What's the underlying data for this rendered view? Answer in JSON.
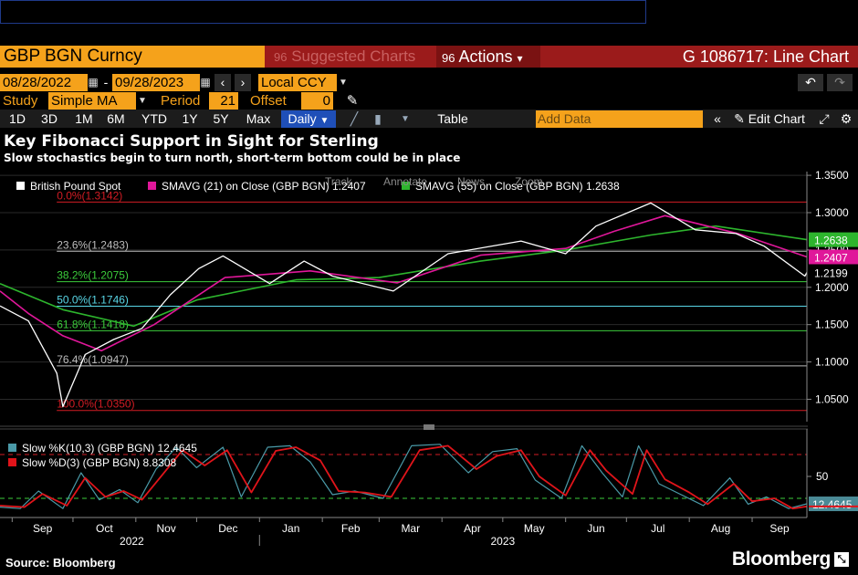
{
  "header": {
    "ticker": "GBP BGN Curncy",
    "suggested": "Suggested Charts",
    "actions": "Actions",
    "actions_prefix": "96",
    "suggested_prefix": "96",
    "chart_id": "G 1086717: Line Chart"
  },
  "range": {
    "start": "08/28/2022",
    "end": "09/28/2023",
    "currency": "Local CCY"
  },
  "study": {
    "label": "Study",
    "type": "Simple MA",
    "period_label": "Period",
    "period": "21",
    "offset_label": "Offset",
    "offset": "0"
  },
  "periods": [
    "1D",
    "3D",
    "1M",
    "6M",
    "YTD",
    "1Y",
    "5Y",
    "Max"
  ],
  "frequency": "Daily",
  "toolbar": {
    "table": "Table",
    "add_data_placeholder": "Add Data",
    "edit_chart": "Edit Chart"
  },
  "headline": "Key Fibonacci Support in Sight for Sterling",
  "subheadline": "Slow stochastics begin to turn north, short-term bottom could be in place",
  "chart_tools": [
    "Track",
    "Annotate",
    "News",
    "Zoom"
  ],
  "footer": {
    "source": "Source: Bloomberg",
    "brand": "Bloomberg"
  },
  "colors": {
    "price": "#ffffff",
    "sma21": "#e0179a",
    "sma55": "#2db52d",
    "k_line": "#4a9aa8",
    "d_line": "#e0141a",
    "accent": "#f5a21b",
    "title_bar": "#9b1b1b"
  },
  "chart_data": [
    {
      "type": "line",
      "legend": [
        {
          "name": "British Pound Spot",
          "value": ""
        },
        {
          "name": "SMAVG (21)  on Close (GBP BGN)",
          "value": "1.2407"
        },
        {
          "name": "SMAVG (55)  on Close (GBP BGN)",
          "value": "1.2638"
        }
      ],
      "series": [
        {
          "name": "British Pound Spot",
          "last": 1.2199,
          "last_label": "1.2199",
          "x": [
            "2022-08-26",
            "2022-09-09",
            "2022-09-23",
            "2022-09-26",
            "2022-10-07",
            "2022-10-21",
            "2022-11-04",
            "2022-11-18",
            "2022-12-02",
            "2022-12-14",
            "2023-01-06",
            "2023-01-23",
            "2023-02-06",
            "2023-03-08",
            "2023-04-04",
            "2023-05-10",
            "2023-06-01",
            "2023-06-16",
            "2023-07-13",
            "2023-08-04",
            "2023-08-24",
            "2023-09-07",
            "2023-09-27",
            "2023-09-28"
          ],
          "values": [
            1.175,
            1.155,
            1.085,
            1.04,
            1.11,
            1.13,
            1.145,
            1.19,
            1.225,
            1.242,
            1.205,
            1.235,
            1.215,
            1.195,
            1.245,
            1.262,
            1.245,
            1.282,
            1.313,
            1.277,
            1.272,
            1.255,
            1.215,
            1.2199
          ]
        },
        {
          "name": "SMAVG (21)",
          "last": 1.2407,
          "last_label": "1.2407",
          "x": [
            "2022-08-26",
            "2022-09-09",
            "2022-09-26",
            "2022-10-15",
            "2022-11-10",
            "2022-12-15",
            "2023-01-26",
            "2023-03-10",
            "2023-04-20",
            "2023-06-01",
            "2023-06-25",
            "2023-07-20",
            "2023-08-25",
            "2023-09-28"
          ],
          "values": [
            1.195,
            1.165,
            1.135,
            1.115,
            1.15,
            1.213,
            1.222,
            1.206,
            1.243,
            1.252,
            1.275,
            1.296,
            1.272,
            1.2407
          ]
        },
        {
          "name": "SMAVG (55)",
          "last": 1.2638,
          "last_label": "1.2638",
          "x": [
            "2022-08-26",
            "2022-09-26",
            "2022-10-31",
            "2022-12-01",
            "2023-01-19",
            "2023-03-01",
            "2023-04-20",
            "2023-06-01",
            "2023-07-13",
            "2023-08-14",
            "2023-09-28"
          ],
          "values": [
            1.205,
            1.17,
            1.148,
            1.183,
            1.21,
            1.213,
            1.235,
            1.25,
            1.27,
            1.282,
            1.2638
          ]
        }
      ],
      "fibonacci": [
        {
          "label": "0.0%(1.3142)",
          "value": 1.3142,
          "color": "#d21c24"
        },
        {
          "label": "23.6%(1.2483)",
          "value": 1.2483,
          "color": "#bdbdbd"
        },
        {
          "label": "38.2%(1.2075)",
          "value": 1.2075,
          "color": "#3bcc3b"
        },
        {
          "label": "50.0%(1.1746)",
          "value": 1.1746,
          "color": "#59d6e6"
        },
        {
          "label": "61.8%(1.1418)",
          "value": 1.1418,
          "color": "#3bcc3b"
        },
        {
          "label": "76.4%(1.0947)",
          "value": 1.0947,
          "color": "#bdbdbd"
        },
        {
          "label": "100.0%(1.0350)",
          "value": 1.035,
          "color": "#d21c24"
        }
      ],
      "yticks": [
        1.35,
        1.3,
        1.25,
        1.2,
        1.15,
        1.1,
        1.05
      ],
      "ytick_labels": [
        "1.3500",
        "1.3000",
        "1.2500",
        "1.2000",
        "1.1500",
        "1.1000",
        "1.0500"
      ],
      "ylim": [
        1.02,
        1.355
      ],
      "xlim": [
        "2022-08-26",
        "2023-09-28"
      ],
      "legend_position": "top-left"
    },
    {
      "type": "line",
      "legend": [
        {
          "name": "Slow %K(10,3) (GBP BGN)",
          "value": "12.4645"
        },
        {
          "name": "Slow %D(3) (GBP BGN)",
          "value": "8.8308"
        }
      ],
      "series": [
        {
          "name": "Slow %K(10,3)",
          "last": 12.4645,
          "last_label": "12.4645",
          "x": [
            "2022-08-26",
            "2022-09-05",
            "2022-09-14",
            "2022-09-26",
            "2022-10-05",
            "2022-10-14",
            "2022-10-24",
            "2022-11-02",
            "2022-11-11",
            "2022-11-21",
            "2022-12-01",
            "2022-12-14",
            "2022-12-23",
            "2023-01-05",
            "2023-01-16",
            "2023-01-26",
            "2023-02-06",
            "2023-02-17",
            "2023-03-03",
            "2023-03-17",
            "2023-03-31",
            "2023-04-14",
            "2023-04-26",
            "2023-05-08",
            "2023-05-17",
            "2023-05-30",
            "2023-06-09",
            "2023-06-19",
            "2023-06-29",
            "2023-07-07",
            "2023-07-17",
            "2023-07-28",
            "2023-08-08",
            "2023-08-21",
            "2023-08-30",
            "2023-09-08",
            "2023-09-19",
            "2023-09-28"
          ],
          "values": [
            8,
            6,
            30,
            6,
            55,
            18,
            32,
            14,
            60,
            90,
            62,
            90,
            22,
            90,
            92,
            70,
            25,
            30,
            20,
            92,
            94,
            55,
            84,
            88,
            45,
            20,
            92,
            55,
            22,
            92,
            40,
            25,
            10,
            48,
            12,
            22,
            6,
            12.4645
          ]
        },
        {
          "name": "Slow %D(3)",
          "last": 8.8308,
          "last_label": "8.8308",
          "x": [
            "2022-08-26",
            "2022-09-07",
            "2022-09-16",
            "2022-09-28",
            "2022-10-07",
            "2022-10-17",
            "2022-10-26",
            "2022-11-04",
            "2022-11-14",
            "2022-11-24",
            "2022-12-05",
            "2022-12-16",
            "2022-12-28",
            "2023-01-09",
            "2023-01-19",
            "2023-01-31",
            "2023-02-09",
            "2023-02-22",
            "2023-03-07",
            "2023-03-21",
            "2023-04-04",
            "2023-04-18",
            "2023-04-28",
            "2023-05-10",
            "2023-05-19",
            "2023-06-01",
            "2023-06-13",
            "2023-06-21",
            "2023-07-04",
            "2023-07-11",
            "2023-07-20",
            "2023-08-01",
            "2023-08-10",
            "2023-08-23",
            "2023-09-01",
            "2023-09-12",
            "2023-09-21",
            "2023-09-28"
          ],
          "values": [
            10,
            8,
            26,
            10,
            48,
            22,
            30,
            18,
            52,
            86,
            65,
            86,
            28,
            85,
            90,
            72,
            30,
            28,
            22,
            86,
            92,
            60,
            78,
            86,
            50,
            24,
            86,
            58,
            26,
            86,
            46,
            28,
            12,
            40,
            16,
            20,
            6,
            8.8308
          ]
        }
      ],
      "levels": [
        80,
        20
      ],
      "yticks": [
        50
      ],
      "ytick_labels": [
        "50"
      ],
      "ylim": [
        0,
        100
      ],
      "xlim": [
        "2022-08-26",
        "2023-09-28"
      ]
    }
  ],
  "x_axis": {
    "months": [
      "Sep",
      "Oct",
      "Nov",
      "Dec",
      "Jan",
      "Feb",
      "Mar",
      "Apr",
      "May",
      "Jun",
      "Jul",
      "Aug",
      "Sep"
    ],
    "month_dates": [
      "2022-09-01",
      "2022-10-01",
      "2022-11-01",
      "2022-12-01",
      "2023-01-01",
      "2023-02-01",
      "2023-03-01",
      "2023-04-01",
      "2023-05-01",
      "2023-06-01",
      "2023-07-01",
      "2023-08-01",
      "2023-09-01"
    ],
    "years": [
      "2022",
      "2023"
    ],
    "year_dates": [
      "2022-10-30",
      "2023-05-01"
    ]
  }
}
